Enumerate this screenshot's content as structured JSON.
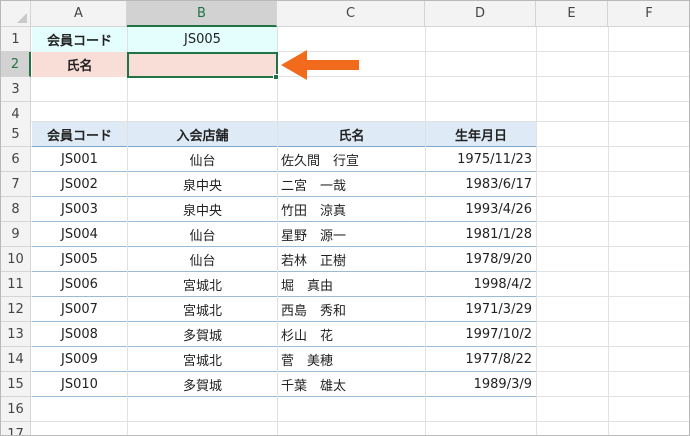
{
  "columns": [
    "A",
    "B",
    "C",
    "D",
    "E",
    "F"
  ],
  "rows": [
    "1",
    "2",
    "3",
    "4",
    "5",
    "6",
    "7",
    "8",
    "9",
    "10",
    "11",
    "12",
    "13",
    "14",
    "15",
    "16",
    "17"
  ],
  "lookup": {
    "code_label": "会員コード",
    "code_value": "JS005",
    "name_label": "氏名",
    "name_value": ""
  },
  "table": {
    "headers": [
      "会員コード",
      "入会店舗",
      "氏名",
      "生年月日"
    ],
    "rows": [
      [
        "JS001",
        "仙台",
        "佐久間　行宣",
        "1975/11/23"
      ],
      [
        "JS002",
        "泉中央",
        "二宮　一哉",
        "1983/6/17"
      ],
      [
        "JS003",
        "泉中央",
        "竹田　涼真",
        "1993/4/26"
      ],
      [
        "JS004",
        "仙台",
        "星野　源一",
        "1981/1/28"
      ],
      [
        "JS005",
        "仙台",
        "若林　正樹",
        "1978/9/20"
      ],
      [
        "JS006",
        "宮城北",
        "堀　真由",
        "1998/4/2"
      ],
      [
        "JS007",
        "宮城北",
        "西島　秀和",
        "1971/3/29"
      ],
      [
        "JS008",
        "多賀城",
        "杉山　花",
        "1997/10/2"
      ],
      [
        "JS009",
        "宮城北",
        "菅　美穂",
        "1977/8/22"
      ],
      [
        "JS010",
        "多賀城",
        "千葉　雄太",
        "1989/3/9"
      ]
    ]
  },
  "colors": {
    "selection": "#217346",
    "arrow": "#f26b1d",
    "label_cyan": "#e4fdfd",
    "label_pink": "#f9ddd7",
    "table_header": "#deeaf6"
  },
  "selected_cell": "B2",
  "annotation_icon": "orange-left-arrow-icon"
}
